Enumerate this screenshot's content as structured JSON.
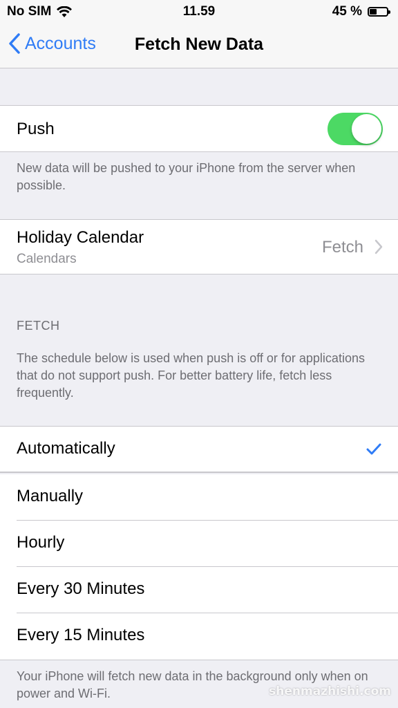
{
  "status_bar": {
    "carrier": "No SIM",
    "time": "11.59",
    "battery_percent": "45 %",
    "battery_level": 0.45
  },
  "nav": {
    "back_label": "Accounts",
    "title": "Fetch New Data"
  },
  "push": {
    "label": "Push",
    "enabled": true,
    "footer": "New data will be pushed to your iPhone from the server when possible."
  },
  "account_row": {
    "title": "Holiday Calendar",
    "subtitle": "Calendars",
    "value": "Fetch"
  },
  "fetch_section": {
    "header": "FETCH",
    "description": "The schedule below is used when push is off or for applications that do not support push. For better battery life, fetch less frequently.",
    "options": [
      {
        "label": "Automatically",
        "selected": true
      },
      {
        "label": "Manually",
        "selected": false
      },
      {
        "label": "Hourly",
        "selected": false
      },
      {
        "label": "Every 30 Minutes",
        "selected": false
      },
      {
        "label": "Every 15 Minutes",
        "selected": false
      }
    ],
    "footer": "Your iPhone will fetch new data in the background only when on power and Wi-Fi."
  },
  "watermark": "shenmazhishi.com",
  "colors": {
    "accent": "#2f7cf6",
    "toggle_on": "#4cd964",
    "background": "#efeff4"
  }
}
